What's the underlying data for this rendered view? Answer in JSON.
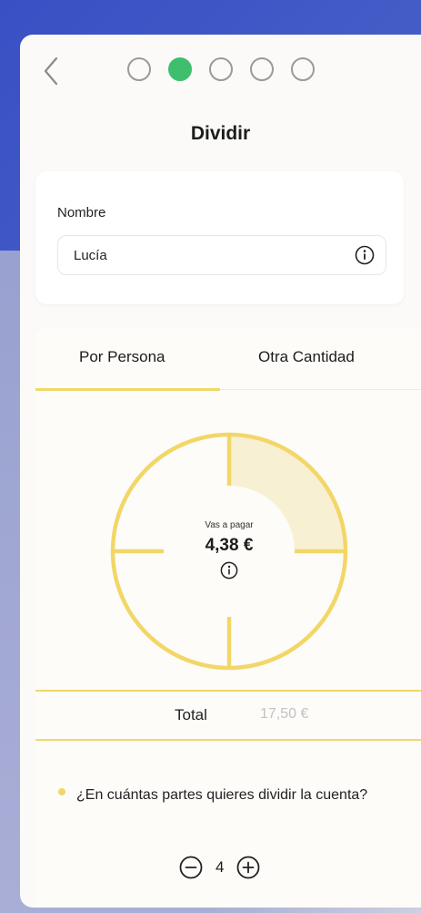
{
  "header": {
    "back_icon": "chevron-left-icon",
    "progress_steps": 5,
    "active_step": 2,
    "title": "Dividir"
  },
  "name_section": {
    "label": "Nombre",
    "value": "Lucía",
    "info_icon": "info-icon"
  },
  "tabs": [
    {
      "label": "Por Persona",
      "active": true
    },
    {
      "label": "Otra Cantidad",
      "active": false
    }
  ],
  "split_chart": {
    "parts": 4,
    "selected_parts": 1,
    "caption": "Vas a pagar",
    "amount": "4,38 €"
  },
  "total": {
    "label": "Total",
    "value": "17,50 €"
  },
  "question": "¿En cuántas partes quieres dividir la cuenta?",
  "stepper": {
    "value": "4",
    "minus_icon": "minus-circle-icon",
    "plus_icon": "plus-circle-icon"
  },
  "colors": {
    "accent_yellow": "#f2d768",
    "active_green": "#3fbf6e",
    "background_blue": "#3850c4"
  }
}
